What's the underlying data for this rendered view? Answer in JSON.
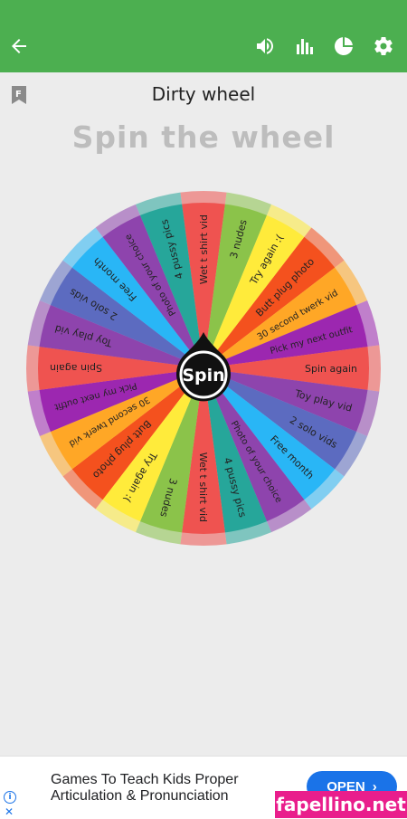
{
  "toolbar": {
    "back_icon": "arrow-left-icon",
    "icons": [
      "volume-icon",
      "bar-chart-icon",
      "pie-chart-icon",
      "gear-icon"
    ],
    "color": "#4caf50"
  },
  "page": {
    "title": "Dirty wheel",
    "headline": "Spin the wheel",
    "bookmark_icon": "bookmark-f-icon",
    "spin_label": "Spin"
  },
  "wheel": {
    "segments": [
      {
        "label": "Wet t shirt vid",
        "color": "#ef5350"
      },
      {
        "label": "3 nudes",
        "color": "#8bc34a"
      },
      {
        "label": "Try again :(",
        "color": "#ffeb3b"
      },
      {
        "label": "Butt plug photo",
        "color": "#f4511e"
      },
      {
        "label": "30 second twerk vid",
        "color": "#ffa726"
      },
      {
        "label": "Pick my next outfit",
        "color": "#9c27b0"
      },
      {
        "label": "Spin again",
        "color": "#ef5350"
      },
      {
        "label": "Toy play vid",
        "color": "#8e44ad"
      },
      {
        "label": "2 solo vids",
        "color": "#5c6bc0"
      },
      {
        "label": "Free month",
        "color": "#29b6f6"
      },
      {
        "label": "Photo of your choice",
        "color": "#8e44ad"
      },
      {
        "label": "4 pussy pics",
        "color": "#26a69a"
      },
      {
        "label": "Wet t shirt vid",
        "color": "#ef5350"
      },
      {
        "label": "3 nudes",
        "color": "#8bc34a"
      },
      {
        "label": "Try again :(",
        "color": "#ffeb3b"
      },
      {
        "label": "Butt plug photo",
        "color": "#f4511e"
      },
      {
        "label": "30 second twerk vid",
        "color": "#ffa726"
      },
      {
        "label": "Pick my next outfit",
        "color": "#9c27b0"
      },
      {
        "label": "Spin again",
        "color": "#ef5350"
      },
      {
        "label": "Toy play vid",
        "color": "#8e44ad"
      },
      {
        "label": "2 solo vids",
        "color": "#5c6bc0"
      },
      {
        "label": "Free month",
        "color": "#29b6f6"
      },
      {
        "label": "Photo of your choice",
        "color": "#8e44ad"
      },
      {
        "label": "4 pussy pics",
        "color": "#26a69a"
      }
    ]
  },
  "ad": {
    "line1": "Games To Teach Kids Proper",
    "line2": "Articulation & Pronunciation",
    "button_label": "OPEN",
    "info_icon": "info-icon",
    "close_icon": "close-icon"
  },
  "watermark": {
    "text": "fapellino.net"
  }
}
